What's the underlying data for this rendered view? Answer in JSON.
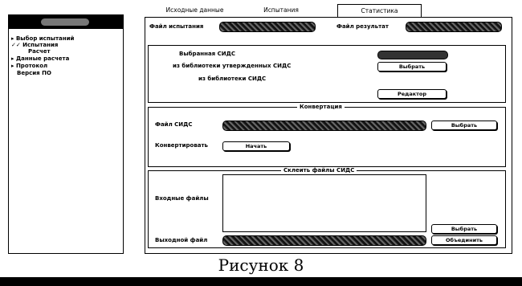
{
  "tabs": [
    {
      "label": "Исходные данные"
    },
    {
      "label": "Испытания"
    },
    {
      "label": "Статистика"
    }
  ],
  "tree": {
    "items": [
      {
        "label": "▸ Выбор испытаний"
      },
      {
        "label": "✓✓ Испытания"
      },
      {
        "label": "Расчет"
      },
      {
        "label": "▸ Данные расчета"
      },
      {
        "label": "▸ Протокол"
      },
      {
        "label": "Версия ПО"
      }
    ]
  },
  "header_row": {
    "test_file_label": "Файл испытания",
    "result_file_label": "Файл результат"
  },
  "sids_group": {
    "selected_label": "Выбранная СИДС",
    "approved_label": "из библиотеки утвержденных СИДС",
    "library_label": "из библиотеки СИДС",
    "select_button": "Выбрать",
    "editor_button": "Редактор"
  },
  "conversion_group": {
    "title": "Конвертация",
    "file_label": "Файл СИДС",
    "browse_button": "Выбрать",
    "convert_label": "Конвертировать",
    "start_button": "Начать"
  },
  "merge_group": {
    "title": "Склеить файлы СИДС",
    "input_label": "Входные файлы",
    "output_label": "Выходной файл",
    "select_button": "Выбрать",
    "merge_button": "Объединить"
  },
  "caption": "Рисунок 8"
}
